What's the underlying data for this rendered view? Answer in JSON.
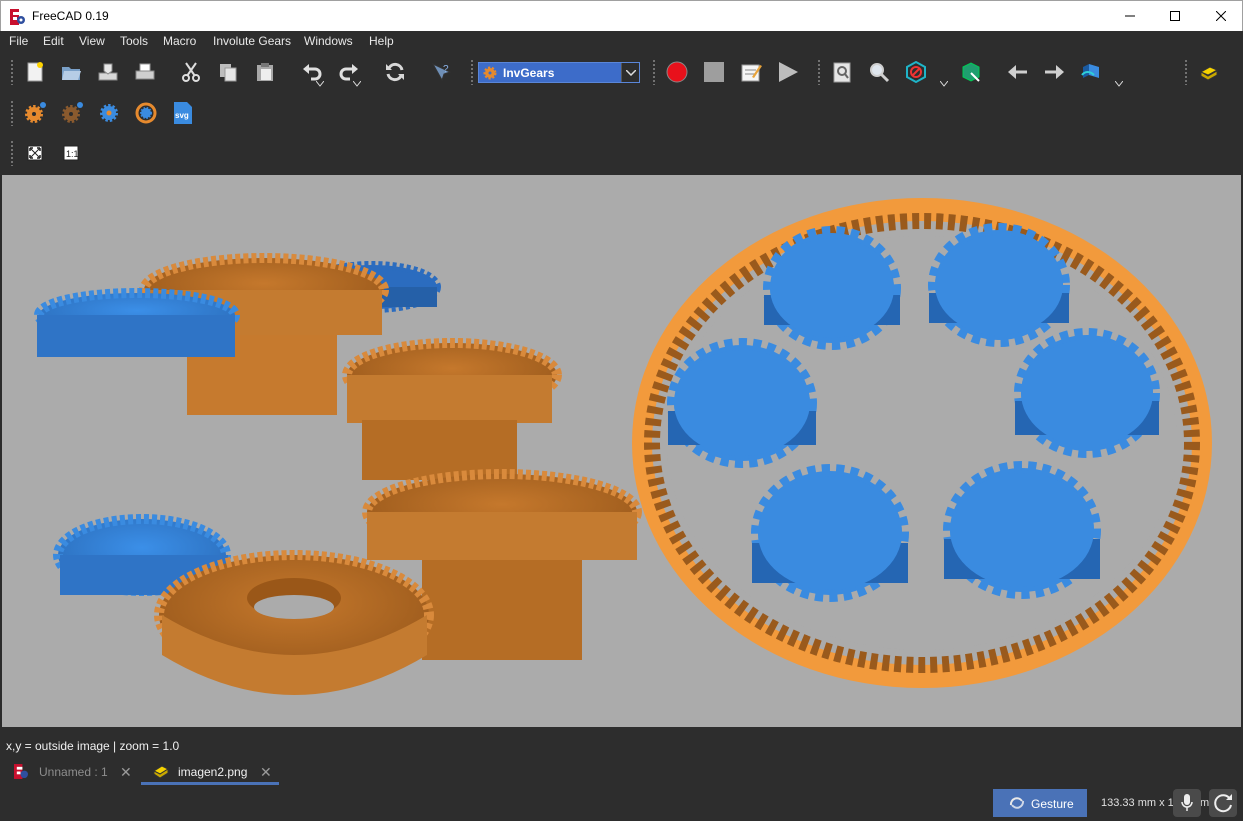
{
  "window": {
    "title": "FreeCAD 0.19"
  },
  "menu": [
    "File",
    "Edit",
    "View",
    "Tools",
    "Macro",
    "Involute Gears",
    "Windows",
    "Help"
  ],
  "toolbar": {
    "workbench": "InvGears",
    "icons_row1": [
      "new-file-icon",
      "open-file-icon",
      "save-icon",
      "print-icon",
      "cut-icon",
      "copy-icon",
      "paste-icon",
      "undo-icon",
      "redo-icon",
      "refresh-icon",
      "whats-this-icon",
      "macro-record-icon",
      "macro-stop-icon",
      "macro-edit-icon",
      "macro-run-icon",
      "fit-all-icon",
      "fit-selection-icon",
      "draw-style-icon",
      "bounding-box-icon",
      "back-icon",
      "forward-icon",
      "std-views-icon",
      "image-workbench-icon"
    ],
    "icons_row2": [
      "involute-gear-icon",
      "cycloid-gear-icon",
      "bevel-gear-icon",
      "internal-gear-icon",
      "export-svg-icon"
    ],
    "icons_row3": [
      "fit-image-icon",
      "actual-size-icon"
    ],
    "svg_badge": "svg"
  },
  "colors": {
    "orange": "#e68a2e",
    "blue": "#3a8be0",
    "viewport": "#ababab",
    "accent": "#4a72b7"
  },
  "status": {
    "text": "x,y = outside image  |  zoom = 1.0"
  },
  "tabs": [
    {
      "label": "Unnamed : 1",
      "active": false
    },
    {
      "label": "imagen2.png",
      "active": true
    }
  ],
  "bottom": {
    "navigation": "Gesture",
    "dimensions": "133.33 mm x 10…0 m"
  }
}
